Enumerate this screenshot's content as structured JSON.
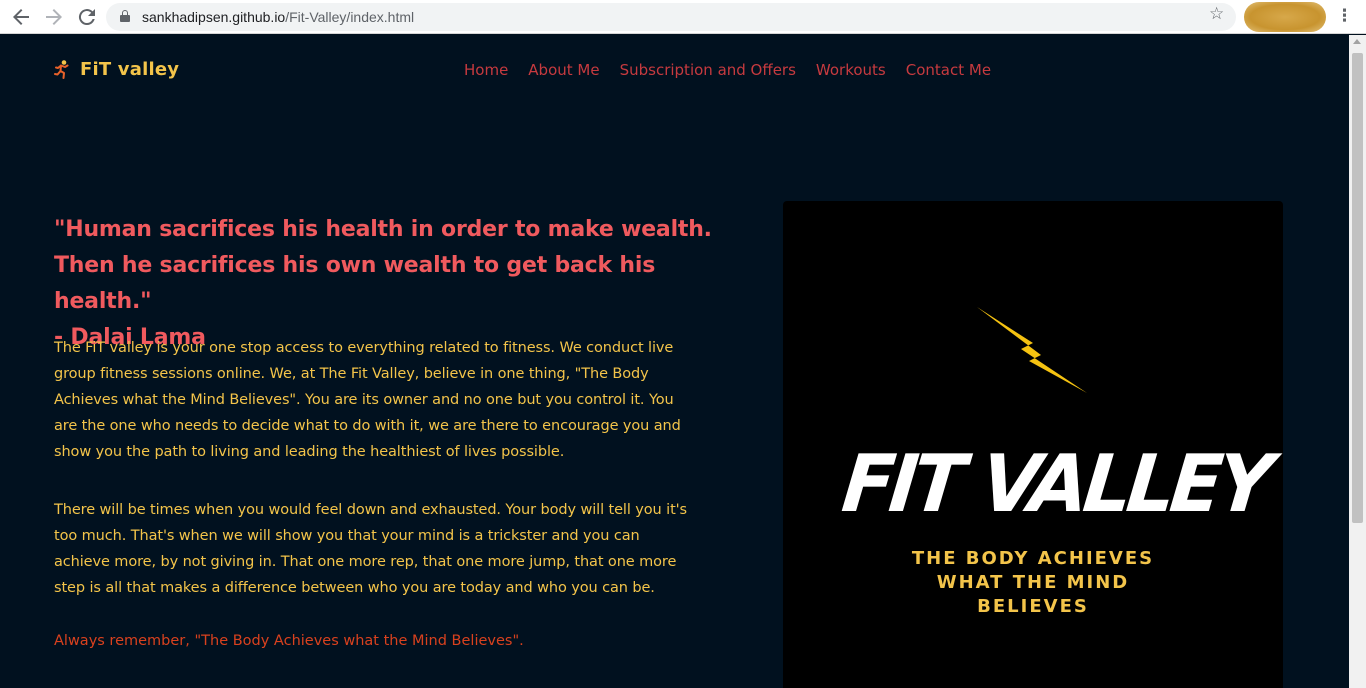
{
  "browser": {
    "url_host": "sankhadipsen.github.io",
    "url_path": "/Fit-Valley/index.html",
    "back_icon": "back-arrow-icon",
    "forward_icon": "forward-arrow-icon",
    "reload_icon": "reload-icon",
    "bookmark_icon": "star-icon",
    "menu_icon": "kebab-menu-icon"
  },
  "site": {
    "brand": "FiT valley",
    "brand_icon": "running-person-icon",
    "nav": [
      "Home",
      "About Me",
      "Subscription and Offers",
      "Workouts",
      "Contact Me"
    ],
    "quote_lines": [
      "\"Human sacrifices his health in order to make wealth.",
      "Then he sacrifices his own wealth to get back his health.\"",
      "- Dalai Lama"
    ],
    "paragraph1": "The FiT valley is your one stop access to everything related to fitness. We conduct live group fitness sessions online. We, at The Fit Valley, believe in one thing, \"The Body Achieves what the Mind Believes\". You are its owner and no one but you control it. You are the one who needs to decide what to do with it, we are there to encourage you and show you the path to living and leading the healthiest of lives possible.",
    "paragraph2": "There will be times when you would feel down and exhausted. Your body will tell you it's too much. That's when we will show you that your mind is a trickster and you can achieve more, by not giving in. That one more rep, that one more jump, that one more step is all that makes a difference between who you are today and who you can be.",
    "remember": "Always remember, \"The Body Achieves what the Mind Believes\".",
    "hero": {
      "logo": "FIT VALLEY",
      "tagline_lines": [
        "THE BODY ACHIEVES",
        "WHAT THE MIND",
        "BELIEVES"
      ],
      "bolt_icon": "lightning-bolt-icon"
    }
  },
  "colors": {
    "background": "#01111f",
    "brand": "#f3c44a",
    "nav": "#c63a3f",
    "quote": "#f05a5e",
    "accent_orange": "#d9411e"
  }
}
